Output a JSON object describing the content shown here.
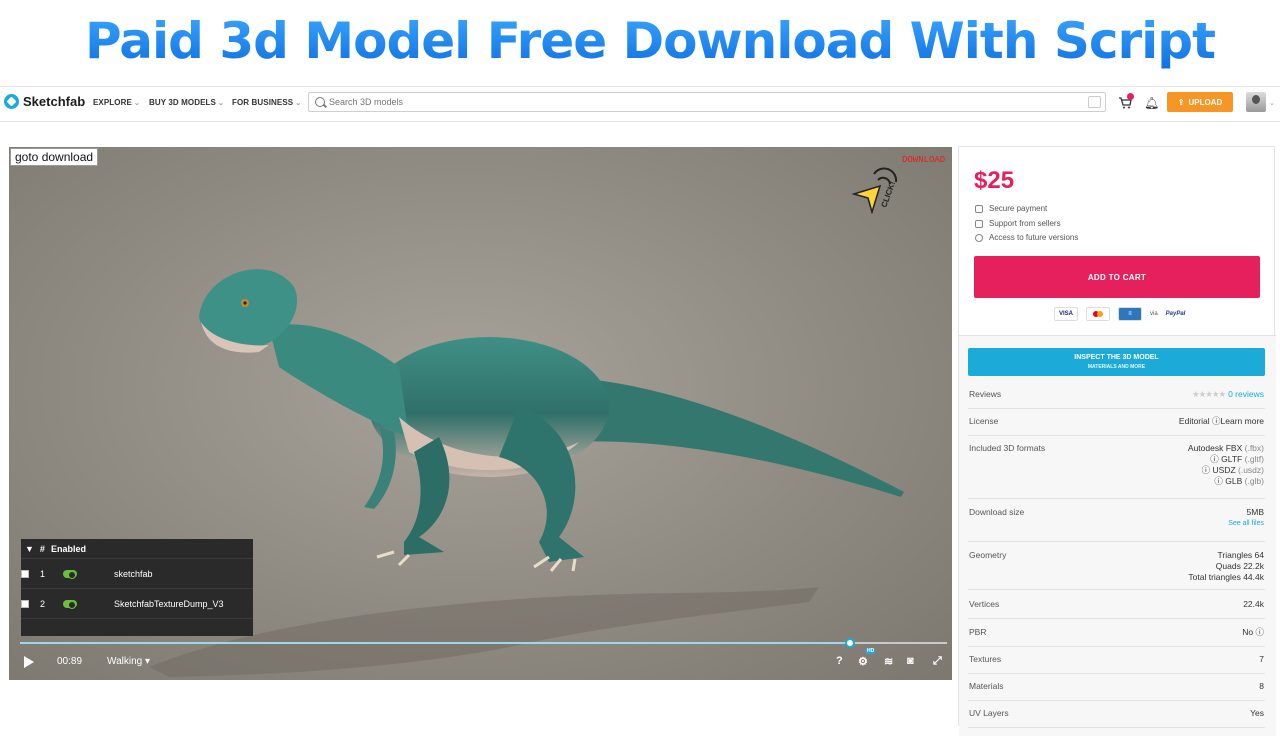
{
  "banner": {
    "title": "Paid 3d Model Free Download With Script"
  },
  "nav": {
    "brand": "Sketchfab",
    "items": [
      "EXPLORE",
      "BUY 3D MODELS",
      "FOR BUSINESS"
    ],
    "search_placeholder": "Search 3D models",
    "upload_label": "UPLOAD"
  },
  "viewer": {
    "goto_label": "goto download",
    "download_overlay": "DOWNLOAD",
    "click_text": "CLICK!",
    "layers": {
      "header": "Enabled",
      "header_num": "#",
      "rows": [
        {
          "num": "1",
          "name": "sketchfab"
        },
        {
          "num": "2",
          "name": "SketchfabTextureDump_V3"
        }
      ]
    },
    "time": "00:89",
    "animation": "Walking",
    "timeline_progress": 0.895,
    "help": "?",
    "hd_badge": "HD"
  },
  "purchase": {
    "price": "$25",
    "perks": [
      "Secure payment",
      "Support from sellers",
      "Access to future versions"
    ],
    "add_to_cart": "ADD TO CART",
    "payment": {
      "visa": "VISA",
      "via": "via",
      "paypal": "PayPal"
    },
    "inspect_main": "INSPECT THE 3D MODEL",
    "inspect_sub": "MATERIALS AND MORE"
  },
  "specs": {
    "reviews_label": "Reviews",
    "reviews_value": "0 reviews",
    "license_label": "License",
    "license_value": "Editorial",
    "license_link": "Learn more",
    "formats_label": "Included 3D formats",
    "formats": [
      {
        "name": "Autodesk FBX",
        "ext": "(.fbx)"
      },
      {
        "name": "GLTF",
        "ext": "(.gltf)"
      },
      {
        "name": "USDZ",
        "ext": "(.usdz)"
      },
      {
        "name": "GLB",
        "ext": "(.glb)"
      }
    ],
    "download_label": "Download size",
    "download_value": "5MB",
    "download_link": "See all files",
    "geometry_label": "Geometry",
    "geometry": [
      "Triangles 64",
      "Quads 22.2k",
      "Total triangles 44.4k"
    ],
    "vertices_label": "Vertices",
    "vertices_value": "22.4k",
    "pbr_label": "PBR",
    "pbr_value": "No",
    "textures_label": "Textures",
    "textures_value": "7",
    "materials_label": "Materials",
    "materials_value": "8",
    "uv_label": "UV Layers",
    "uv_value": "Yes"
  },
  "colors": {
    "accent": "#1caad9",
    "price": "#e5205c",
    "upload": "#f79624",
    "banner": "#1a8cf0"
  }
}
